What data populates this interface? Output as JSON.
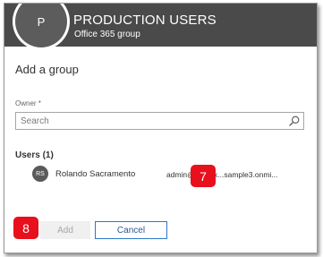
{
  "header": {
    "avatar_letter": "P",
    "title": "PRODUCTION USERS",
    "subtitle": "Office 365 group"
  },
  "panel": {
    "title": "Add a group",
    "owner_label": "Owner *",
    "search_placeholder": "Search",
    "search_icon": "search-icon"
  },
  "users": {
    "heading": "Users (1)",
    "items": [
      {
        "initials": "RS",
        "name": "Rolando Sacramento",
        "email": "admin@m365x...sample3.onmi..."
      }
    ]
  },
  "buttons": {
    "add_label": "Add",
    "cancel_label": "Cancel"
  },
  "callouts": {
    "seven": "7",
    "eight": "8"
  },
  "colors": {
    "header_bg": "#4a4a4a",
    "callout_red": "#e8101c",
    "cancel_border": "#2b78c5"
  }
}
